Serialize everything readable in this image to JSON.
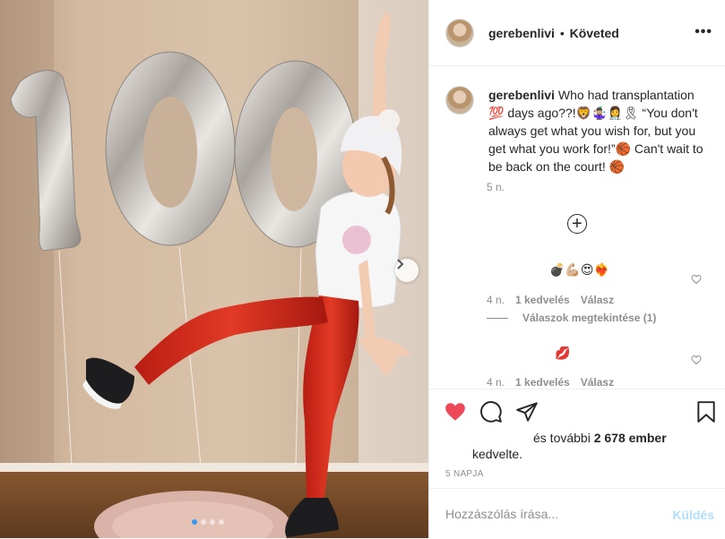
{
  "post": {
    "username": "gerebenlivi",
    "separator": "•",
    "follow_status": "Követed",
    "more_icon": "more-options-icon",
    "caption": {
      "username": "gerebenlivi",
      "text": "Who had transplantation 💯 days ago??!🦁🤹🏼‍♀️👩‍⚕️🎗 “You don't always get what you wish for, but you get what you work for!”🏀 Can't wait to be back on the court! 🏀",
      "time": "5 n."
    },
    "comments": [
      {
        "text": "💣💪🏼😍❤️‍🔥",
        "time": "4 n.",
        "likes": "1 kedvelés",
        "reply": "Válasz",
        "view_replies": "Válaszok megtekintése (1)"
      },
      {
        "text": "💋",
        "time": "4 n.",
        "likes": "1 kedvelés",
        "reply": "Válasz"
      }
    ],
    "likes_prefix": "és további",
    "likes_count": "2 678 ember",
    "likes_suffix": "kedvelte.",
    "date": "5 NAPJA",
    "comment_placeholder": "Hozzászólás írása...",
    "post_button": "Küldés",
    "carousel": {
      "count": 4,
      "active_index": 0
    },
    "balloon_text": "100",
    "colors": {
      "like": "#ed4956",
      "link": "#3897f0",
      "post_disabled": "#b2dffc",
      "pants": "#d42618"
    }
  }
}
